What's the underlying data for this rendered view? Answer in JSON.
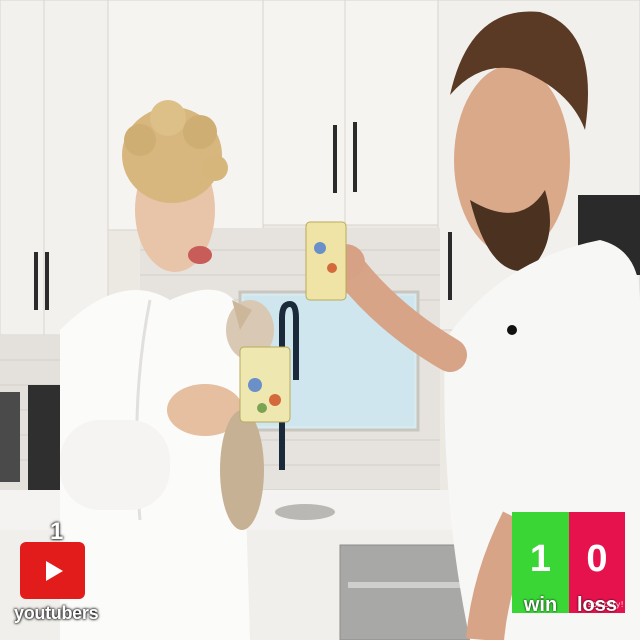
{
  "overlay": {
    "youtuber_count": "1",
    "youtuber_label": "youtubers",
    "youtube_icon": "youtube-play-icon",
    "youtube_color": "#e21b1b"
  },
  "scoreboard": {
    "win_value": "1",
    "win_label": "win",
    "win_color": "#39d635",
    "loss_value": "0",
    "loss_label": "loss",
    "loss_color": "#e6124d",
    "watermark": "sos ccty!"
  }
}
